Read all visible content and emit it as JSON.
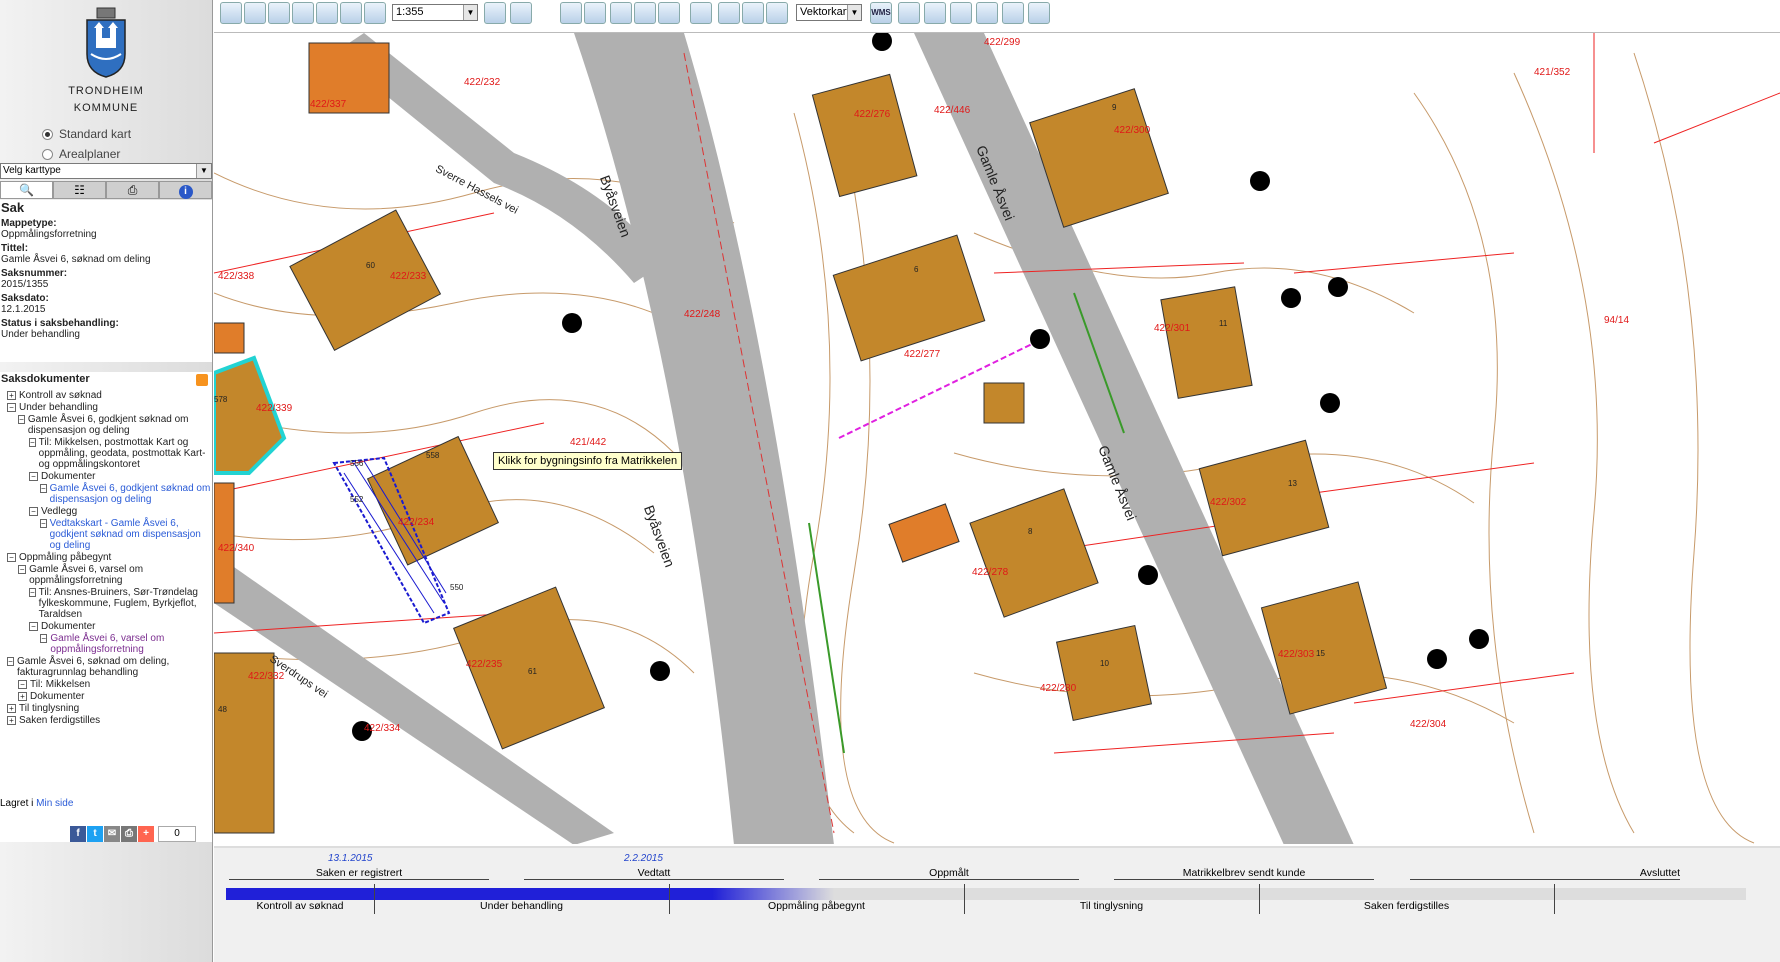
{
  "logo": {
    "line1": "TRONDHEIM",
    "line2": "KOMMUNE"
  },
  "map_type_options": {
    "standard": "Standard kart",
    "areal": "Arealplaner"
  },
  "karttype": {
    "value": "Velg karttype"
  },
  "sidebar_tabs": [
    "search-icon",
    "legend-icon",
    "print-icon",
    "info-icon"
  ],
  "sak": {
    "heading": "Sak",
    "mappetype_label": "Mappetype:",
    "mappetype": "Oppmålingsforretning",
    "tittel_label": "Tittel:",
    "tittel": "Gamle Åsvei 6, søknad om deling",
    "saksnummer_label": "Saksnummer:",
    "saksnummer": "2015/1355",
    "saksdato_label": "Saksdato:",
    "saksdato": "12.1.2015",
    "status_label": "Status i saksbehandling:",
    "status": "Under behandling"
  },
  "saksdokumenter": {
    "heading": "Saksdokumenter",
    "tree": [
      {
        "sign": "+",
        "indent": 0,
        "text": "Kontroll av søknad",
        "cls": ""
      },
      {
        "sign": "−",
        "indent": 0,
        "text": "Under behandling",
        "cls": ""
      },
      {
        "sign": "−",
        "indent": 1,
        "text": "Gamle Åsvei 6, godkjent søknad om dispensasjon og deling",
        "cls": ""
      },
      {
        "sign": "−",
        "indent": 2,
        "text": "Til: Mikkelsen, postmottak Kart og oppmåling, geodata, postmottak Kart- og oppmålingskontoret",
        "cls": ""
      },
      {
        "sign": "−",
        "indent": 2,
        "text": "Dokumenter",
        "cls": ""
      },
      {
        "sign": "−",
        "indent": 3,
        "text": "Gamle Åsvei 6, godkjent søknad om dispensasjon og deling",
        "cls": "lnk-blue"
      },
      {
        "sign": "−",
        "indent": 2,
        "text": "Vedlegg",
        "cls": ""
      },
      {
        "sign": "−",
        "indent": 3,
        "text": "Vedtakskart - Gamle Åsvei 6, godkjent søknad om dispensasjon og deling",
        "cls": "lnk-blue"
      },
      {
        "sign": "−",
        "indent": 0,
        "text": "Oppmåling påbegynt",
        "cls": ""
      },
      {
        "sign": "−",
        "indent": 1,
        "text": "Gamle Åsvei 6, varsel om oppmålingsforretning",
        "cls": ""
      },
      {
        "sign": "−",
        "indent": 2,
        "text": "Til: Ansnes-Bruiners, Sør-Trøndelag fylkeskommune, Fuglem, Byrkjeflot, Taraldsen",
        "cls": ""
      },
      {
        "sign": "−",
        "indent": 2,
        "text": "Dokumenter",
        "cls": ""
      },
      {
        "sign": "−",
        "indent": 3,
        "text": "Gamle Åsvei 6, varsel om oppmålingsforretning",
        "cls": "lnk-purple"
      },
      {
        "sign": "−",
        "indent": 0,
        "text": "Gamle Åsvei 6, søknad om deling, fakturagrunnlag behandling",
        "cls": ""
      },
      {
        "sign": "−",
        "indent": 1,
        "text": "Til: Mikkelsen",
        "cls": ""
      },
      {
        "sign": "+",
        "indent": 1,
        "text": "Dokumenter",
        "cls": ""
      },
      {
        "sign": "+",
        "indent": 0,
        "text": "Til tinglysning",
        "cls": ""
      },
      {
        "sign": "+",
        "indent": 0,
        "text": "Saken ferdigstilles",
        "cls": ""
      }
    ]
  },
  "lagret": {
    "prefix": "Lagret i",
    "link": "Min side"
  },
  "share": {
    "count": "0"
  },
  "toolbar": {
    "scale": "1:355",
    "layer": "Vektorkart",
    "wms_label": "WMS"
  },
  "tooltip": "Klikk for bygningsinfo fra Matrikkelen",
  "map": {
    "roads": [
      "Byåsveien",
      "Byåsveien",
      "Gamle Åsvei",
      "Gamle Åsvei",
      "Sverre Hassels vei",
      "Sverdrups vei"
    ],
    "parcels": [
      "422/337",
      "422/232",
      "422/299",
      "422/276",
      "422/446",
      "422/300",
      "421/352",
      "422/338",
      "60",
      "422/233",
      "422/248",
      "6",
      "422/277",
      "422/301",
      "11",
      "94/14",
      "578",
      "422/339",
      "421/442",
      "422/234",
      "556",
      "552",
      "558",
      "550",
      "13",
      "422/302",
      "422/340",
      "422/278",
      "8",
      "422/235",
      "61",
      "10",
      "422/280",
      "422/303",
      "15",
      "422/332",
      "48",
      "422/334",
      "422/304",
      "9"
    ]
  },
  "timeline": {
    "dates": [
      "13.1.2015",
      "2.2.2015"
    ],
    "milestones": [
      "Saken er registrert",
      "Vedtatt",
      "Oppmålt",
      "Matrikkelbrev sendt kunde",
      "Avsluttet"
    ],
    "phases": [
      "Kontroll av søknad",
      "Under behandling",
      "Oppmåling påbegynt",
      "Til tinglysning",
      "Saken ferdigstilles"
    ],
    "progress": 0.4
  }
}
